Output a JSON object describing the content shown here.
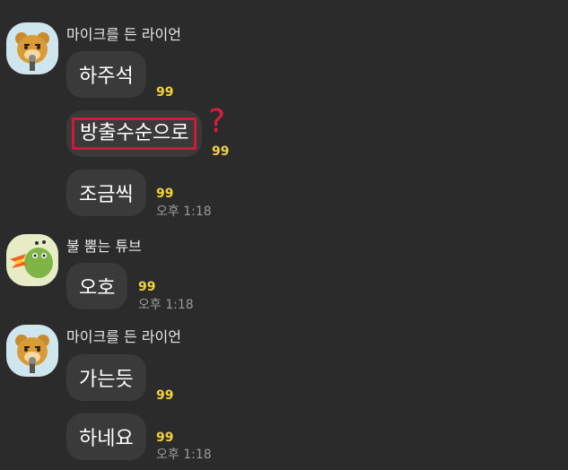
{
  "groups": [
    {
      "sender": "마이크를 든 라이언",
      "messages": [
        {
          "text": "하주석",
          "count": "99",
          "time": ""
        },
        {
          "text": "방출수순으로",
          "count": "99",
          "time": ""
        },
        {
          "text": "조금씩",
          "count": "99",
          "time": "오후 1:18"
        }
      ]
    },
    {
      "sender": "불 뿜는 튜브",
      "messages": [
        {
          "text": "오호",
          "count": "99",
          "time": "오후 1:18"
        }
      ]
    },
    {
      "sender": "마이크를 든 라이언",
      "messages": [
        {
          "text": "가는듯",
          "count": "99",
          "time": ""
        },
        {
          "text": "하네요",
          "count": "99",
          "time": "오후 1:18"
        }
      ]
    }
  ],
  "annotation": {
    "question_mark": "?"
  },
  "icons": {
    "avatar_1": "lion-with-microphone-icon",
    "avatar_2": "fire-breathing-tube-icon",
    "avatar_3": "lion-with-microphone-icon"
  },
  "colors": {
    "background": "#2b2b2b",
    "bubble": "#3a3a3a",
    "unread_count": "#f3d33a",
    "highlight": "#d01a3a"
  }
}
